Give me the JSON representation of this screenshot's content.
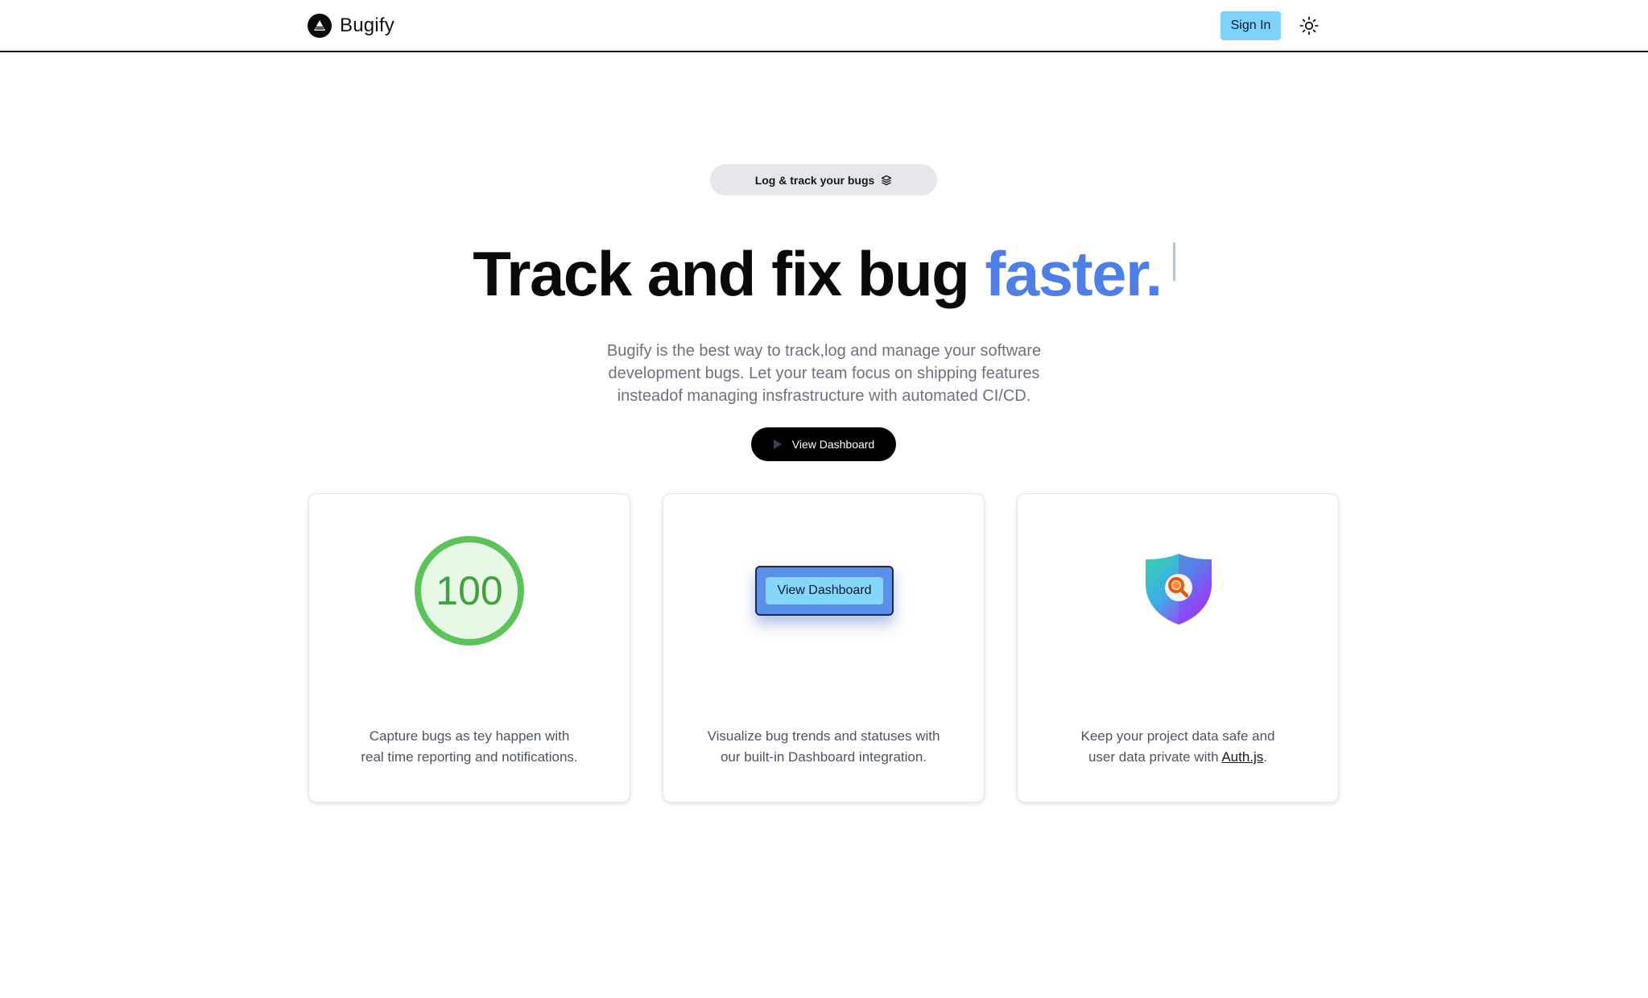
{
  "nav": {
    "brand": "Bugify",
    "sign_in_label": "Sign In"
  },
  "hero": {
    "badge": "Log & track your bugs",
    "title_main": "Track and fix bug ",
    "title_accent": "faster.",
    "subtitle_lines": [
      "Bugify is the best way to track,log and manage your software",
      "development bugs. Let your team focus on shipping features",
      "insteadof managing insfrastructure with automated CI/CD."
    ],
    "cta_label": "View Dashboard"
  },
  "features": [
    {
      "visual_value": "100",
      "lines": [
        "Capture bugs as tey happen with",
        "real time reporting and notifications."
      ]
    },
    {
      "visual_label": "View Dashboard",
      "lines": [
        "Visualize bug trends and statuses with",
        "our built-in Dashboard integration."
      ]
    },
    {
      "lines": [
        "Keep your project data safe and"
      ],
      "line2_prefix": "user data private with ",
      "link_text": "Auth.js",
      "line2_suffix": "."
    }
  ],
  "colors": {
    "accent": "#4f7fe6",
    "sign_in_bg": "#7dd3fc",
    "score_green": "#5cc25a"
  },
  "icons": [
    "bugify-logo-icon",
    "sun-icon",
    "layers-icon",
    "play-icon",
    "shield-search-icon"
  ]
}
